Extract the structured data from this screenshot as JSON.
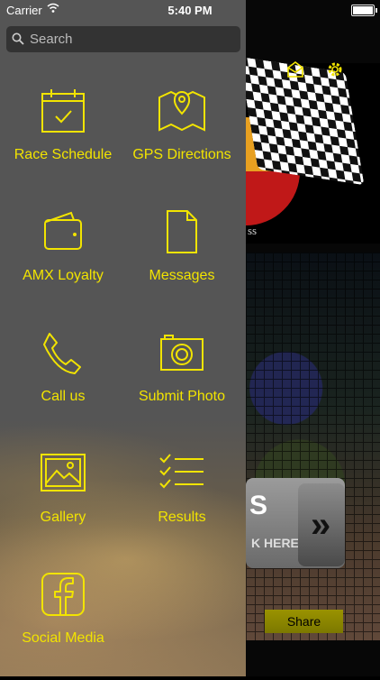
{
  "status_bar": {
    "carrier": "Carrier",
    "time": "5:40 PM"
  },
  "search": {
    "placeholder": "Search"
  },
  "menu_items": [
    {
      "label": "Race Schedule",
      "icon": "calendar-icon"
    },
    {
      "label": "GPS Directions",
      "icon": "map-pin-icon"
    },
    {
      "label": "AMX Loyalty",
      "icon": "wallet-icon"
    },
    {
      "label": "Messages",
      "icon": "document-icon"
    },
    {
      "label": "Call us",
      "icon": "phone-icon"
    },
    {
      "label": "Submit Photo",
      "icon": "camera-icon"
    },
    {
      "label": "Gallery",
      "icon": "image-icon"
    },
    {
      "label": "Results",
      "icon": "checklist-icon"
    },
    {
      "label": "Social Media",
      "icon": "facebook-icon"
    }
  ],
  "main": {
    "hero_tag": "ss",
    "banner_big": "S",
    "banner_small": "K HERE",
    "share_label": "Share"
  },
  "colors": {
    "accent": "#f2e400",
    "menu_bg": "#555555"
  }
}
